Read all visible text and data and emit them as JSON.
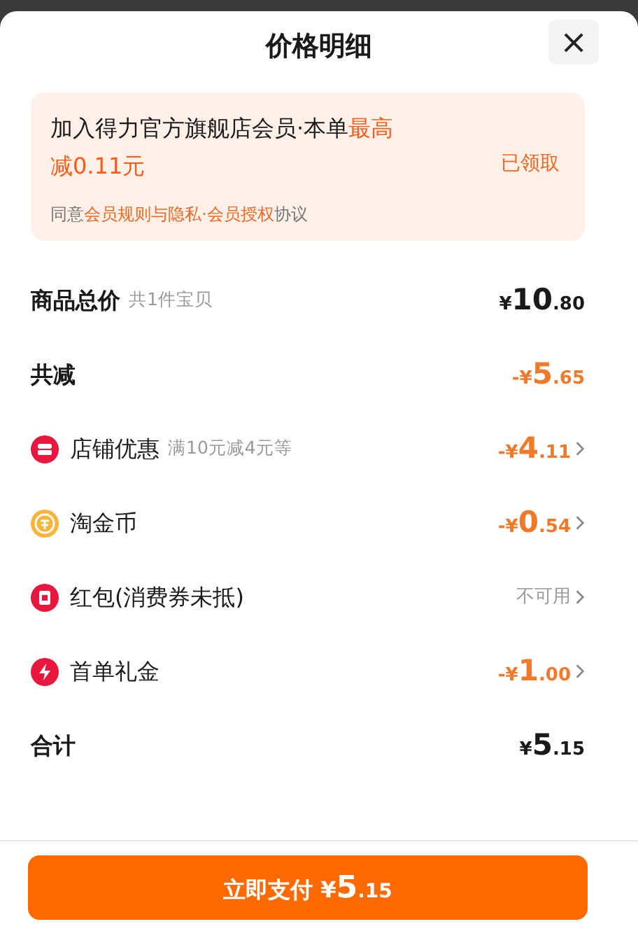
{
  "title": "价格明细",
  "close": "×",
  "member_banner": {
    "text": "加入得力官方旗舰店会员·本单",
    "highlight": "最高减0.11元",
    "status": "已领取",
    "agreement": {
      "before": "同意",
      "link": "会员规则与隐私·会员授权",
      "after": "协议"
    }
  },
  "rows": [
    {
      "kind": "total",
      "label": "商品总价",
      "note": "共1件宝贝",
      "amount": {
        "prefix": "¥",
        "main": "10",
        "cents": ".80"
      }
    },
    {
      "kind": "saving",
      "label": "共减",
      "amount": {
        "prefix": "-¥",
        "main": "5",
        "cents": ".65"
      }
    },
    {
      "kind": "discount",
      "label": "店铺优惠",
      "note": "满10元减4元等",
      "amount": {
        "prefix": "-¥",
        "main": "4",
        "cents": ".11"
      }
    },
    {
      "kind": "discount",
      "label": "淘金币",
      "amount": {
        "prefix": "-¥",
        "main": "0",
        "cents": ".54"
      }
    },
    {
      "kind": "unavailable",
      "label": "红包(消费券未抵)",
      "value": "不可用"
    },
    {
      "kind": "discount",
      "label": "首单礼金",
      "amount": {
        "prefix": "-¥",
        "main": "1",
        "cents": ".00"
      }
    },
    {
      "kind": "total",
      "label": "合计",
      "amount": {
        "prefix": "¥",
        "main": "5",
        "cents": ".15"
      }
    }
  ],
  "pay_button": {
    "label": "立即支付",
    "amount": {
      "prefix": "¥",
      "main": "5",
      "cents": ".15"
    }
  }
}
